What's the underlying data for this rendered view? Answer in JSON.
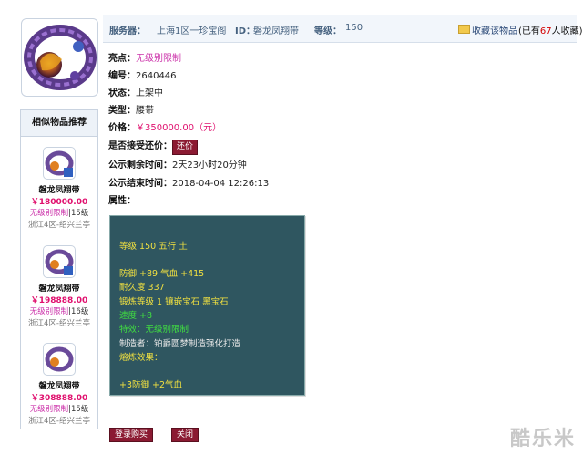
{
  "header": {
    "server_label": "服务器：",
    "server_value": "上海1区一珍宝阁",
    "id_label": "ID：",
    "id_value": "磐龙凤翔带",
    "level_label": "等级：",
    "level_value": "150",
    "favorite_label": "收藏该物品",
    "favorite_count_prefix": "(已有",
    "favorite_count": "67",
    "favorite_count_suffix": "人收藏)"
  },
  "details": {
    "highlight_label": "亮点：",
    "highlight_value": "无级别限制",
    "number_label": "编号：",
    "number_value": "2640446",
    "status_label": "状态：",
    "status_value": "上架中",
    "type_label": "类型：",
    "type_value": "腰带",
    "price_label": "价格：",
    "price_value": "￥350000.00（元）",
    "bargain_label": "是否接受还价：",
    "bargain_button": "还价",
    "remaining_label": "公示剩余时间：",
    "remaining_value": "2天23小时20分钟",
    "end_label": "公示结束时间：",
    "end_value": "2018-04-04 12:26:13",
    "attr_label": "属性："
  },
  "attributes": {
    "line1": "等级 150 五行 土",
    "line2": "防御 +89 气血 +415",
    "line3": "耐久度 337",
    "line4": "锻炼等级 1 镶嵌宝石 黑宝石",
    "line5": "速度 +8",
    "line6": "特效：无级别限制",
    "line7": "制造者：铂爵圆梦制造强化打造",
    "line8": "熔炼效果：",
    "line9": "+3防御 +2气血"
  },
  "similar": {
    "title": "相似物品推荐",
    "items": [
      {
        "name": "磐龙凤翔带",
        "price": "￥180000.00",
        "tag": "无级别限制",
        "level": "|15级",
        "server": "浙江4区-绍兴兰亭"
      },
      {
        "name": "磐龙凤翔带",
        "price": "￥198888.00",
        "tag": "无级别限制",
        "level": "|16级",
        "server": "浙江4区-绍兴兰亭"
      },
      {
        "name": "磐龙凤翔带",
        "price": "￥308888.00",
        "tag": "无级别限制",
        "level": "|15级",
        "server": "浙江4区-绍兴兰亭"
      }
    ]
  },
  "footer": {
    "login_buy": "登录购买",
    "close": "关闭"
  },
  "watermark": "酷乐米",
  "colors": {
    "accent_dark_red": "#8b1a32",
    "price_pink": "#e0106e",
    "attr_box_bg": "#2f5660",
    "header_text": "#44607e"
  }
}
